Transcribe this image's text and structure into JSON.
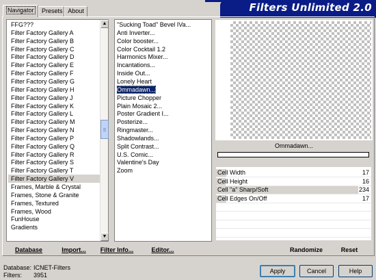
{
  "tabs": [
    "Navigator",
    "Presets",
    "About"
  ],
  "title": "Filters Unlimited 2.0",
  "categories": {
    "items": [
      "FFG???",
      "Filter Factory Gallery A",
      "Filter Factory Gallery B",
      "Filter Factory Gallery C",
      "Filter Factory Gallery D",
      "Filter Factory Gallery E",
      "Filter Factory Gallery F",
      "Filter Factory Gallery G",
      "Filter Factory Gallery H",
      "Filter Factory Gallery J",
      "Filter Factory Gallery K",
      "Filter Factory Gallery L",
      "Filter Factory Gallery M",
      "Filter Factory Gallery N",
      "Filter Factory Gallery P",
      "Filter Factory Gallery Q",
      "Filter Factory Gallery R",
      "Filter Factory Gallery S",
      "Filter Factory Gallery T",
      "Filter Factory Gallery V",
      "Frames, Marble & Crystal",
      "Frames, Stone & Granite",
      "Frames, Textured",
      "Frames, Wood",
      "FunHouse",
      "Gradients"
    ],
    "selected_index": 19
  },
  "filters": {
    "items": [
      "\"Sucking Toad\"  Bevel IVa...",
      "Anti Inverter...",
      "Color booster...",
      "Color Cocktail 1.2",
      "Harmonics Mixer...",
      "Incantations...",
      "Inside Out...",
      "Lonely Heart",
      "Ommadawn...",
      "Picture Chopper",
      "Plain Mosaic 2...",
      "Poster Gradient I...",
      "Posterize...",
      "Ringmaster...",
      "Shadowlands...",
      "Split Contrast...",
      "U.S. Comic...",
      "Valentine's Day",
      "Zoom"
    ],
    "selected_index": 8
  },
  "bottom_buttons": {
    "database": "Database",
    "import": "Import...",
    "filter_info": "Filter Info...",
    "editor": "Editor...",
    "randomize": "Randomize",
    "reset": "Reset"
  },
  "preview_caption": "Ommadawn...",
  "progress": 0,
  "params": [
    {
      "label": "Cell Width",
      "value": "17",
      "fraction": 0.067
    },
    {
      "label": "Cell Height",
      "value": "16",
      "fraction": 0.063
    },
    {
      "label": "Cell \"a\" Sharp/Soft",
      "value": "234",
      "fraction": 0.918
    },
    {
      "label": "Cell Edges On/Off",
      "value": "17",
      "fraction": 0.067
    },
    {
      "label": "",
      "value": "",
      "fraction": 0
    },
    {
      "label": "",
      "value": "",
      "fraction": 0
    },
    {
      "label": "",
      "value": "",
      "fraction": 0
    },
    {
      "label": "",
      "value": "",
      "fraction": 0
    }
  ],
  "footer": {
    "database_label": "Database:",
    "database_value": "ICNET-Filters",
    "filters_label": "Filters:",
    "filters_value": "3951"
  },
  "dialog_buttons": {
    "apply": "Apply",
    "cancel": "Cancel",
    "help": "Help"
  }
}
